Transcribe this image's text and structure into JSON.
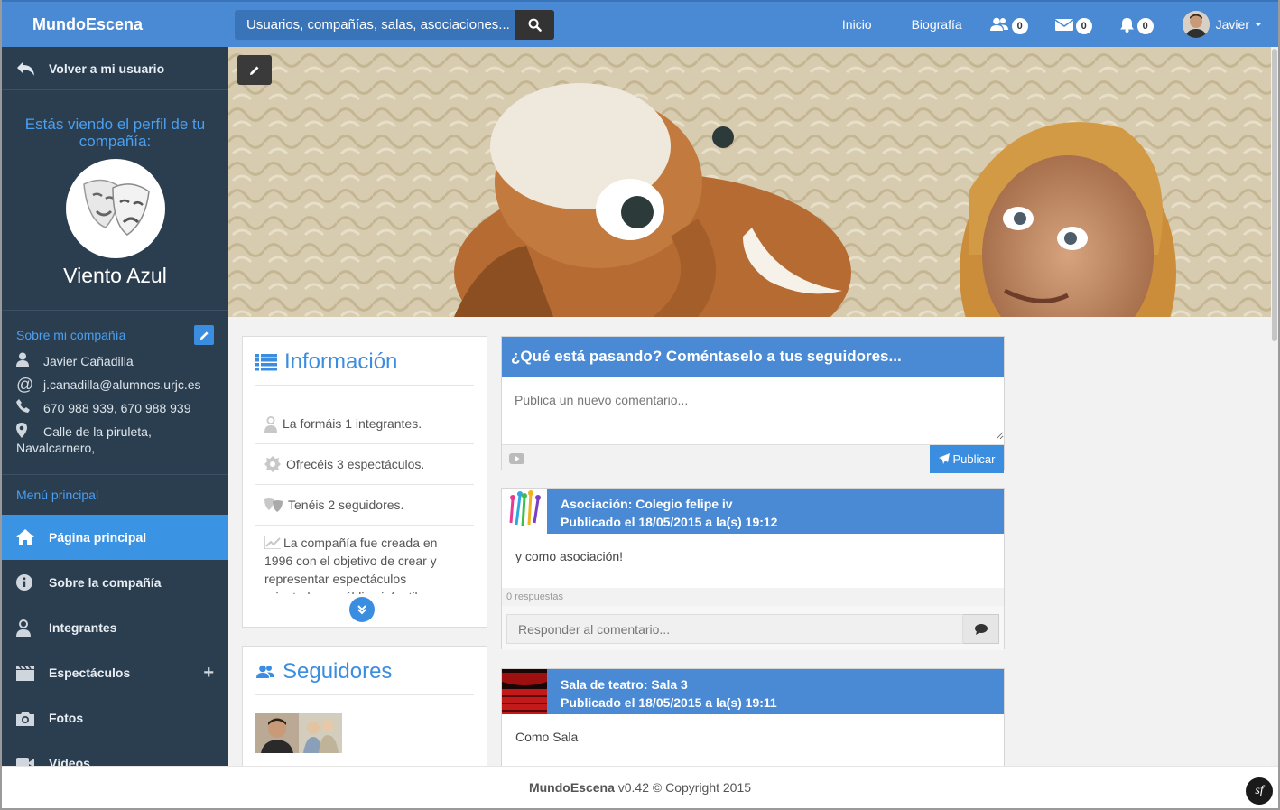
{
  "navbar": {
    "brand": "MundoEscena",
    "search_placeholder": "Usuarios, compañías, salas, asociaciones...",
    "links": {
      "home": "Inicio",
      "biography": "Biografía"
    },
    "badges": {
      "friends": "0",
      "messages": "0",
      "notifications": "0"
    },
    "user_name": "Javier"
  },
  "sidebar": {
    "back_label": "Volver a mi usuario",
    "viewing_text": "Estás viendo el perfil de tu compañía:",
    "company_name": "Viento Azul",
    "about_header": "Sobre mi compañía",
    "contact": {
      "name": "Javier Cañadilla",
      "email": "j.canadilla@alumnos.urjc.es",
      "phone": "670 988 939, 670 988 939",
      "address_line1": "Calle de la piruleta,",
      "address_line2": "Navalcarnero,"
    },
    "menu_header": "Menú principal",
    "menu": [
      {
        "label": "Página principal"
      },
      {
        "label": "Sobre la compañía"
      },
      {
        "label": "Integrantes"
      },
      {
        "label": "Espectáculos"
      },
      {
        "label": "Fotos"
      },
      {
        "label": "Vídeos"
      }
    ]
  },
  "info_card": {
    "title": "Información",
    "items": [
      "La formáis 1 integrantes.",
      "Ofrecéis 3 espectáculos.",
      "Tenéis 2 seguidores."
    ],
    "description": "La compañía fue creada en 1996 con el objetivo de crear y representar espectáculos orientados a público infantil y"
  },
  "followers_card": {
    "title": "Seguidores"
  },
  "composer": {
    "title": "¿Qué está pasando? Coméntaselo a tus seguidores...",
    "placeholder": "Publica un nuevo comentario...",
    "publish_label": "Publicar"
  },
  "posts": [
    {
      "author": "Asociación: Colegio felipe iv",
      "date": "Publicado el 18/05/2015 a la(s) 19:12",
      "body": "y como asociación!",
      "replies": "0 respuestas",
      "reply_placeholder": "Responder al comentario..."
    },
    {
      "author": "Sala de teatro: Sala 3",
      "date": "Publicado el 18/05/2015 a la(s) 19:11",
      "body": "Como Sala"
    }
  ],
  "footer": {
    "brand": "MundoEscena",
    "text": "v0.42 © Copyright 2015",
    "sf_logo": "sf"
  },
  "colors": {
    "primary": "#4a89d3",
    "sidebar_bg": "#2b3e50",
    "accent": "#3b8de0"
  }
}
